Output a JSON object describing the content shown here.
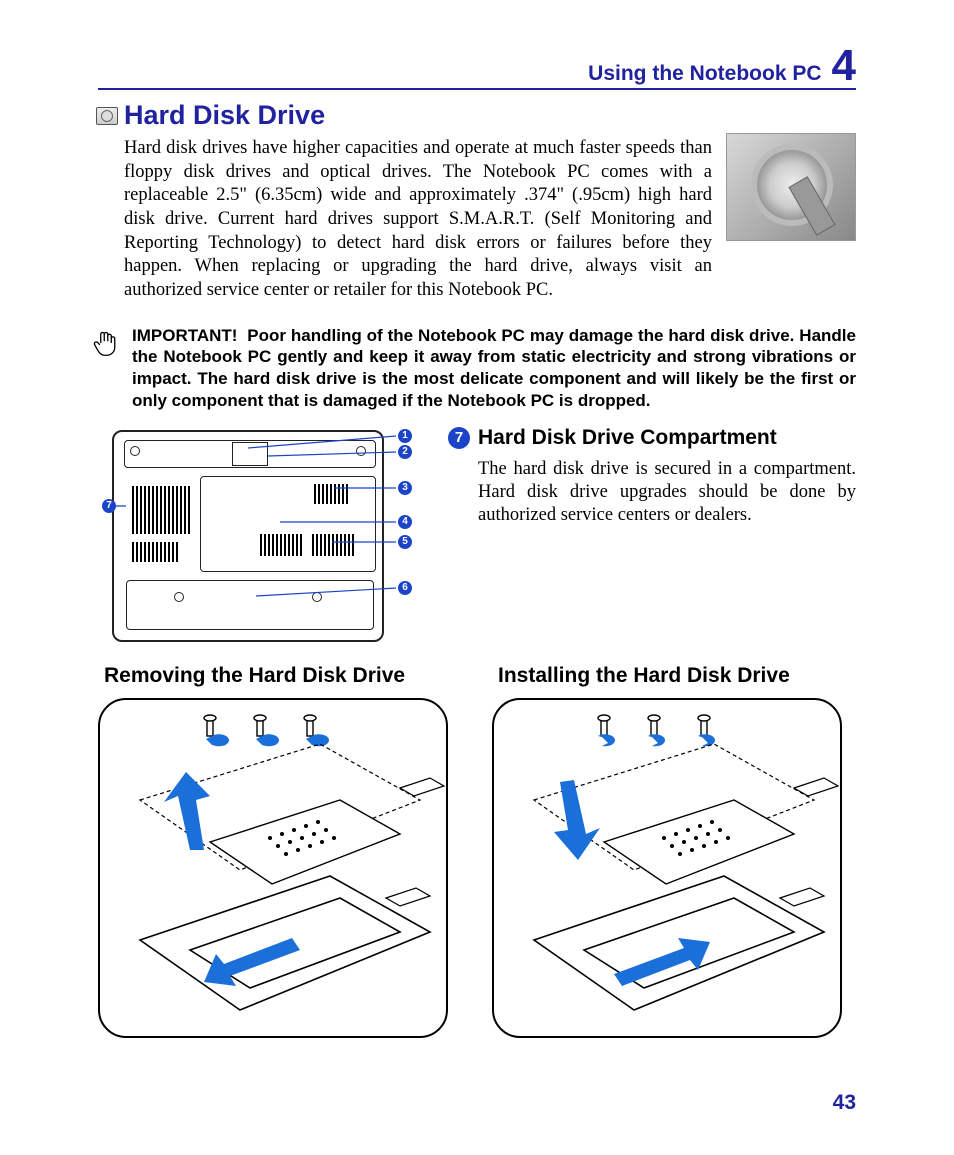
{
  "header": {
    "title": "Using the Notebook PC",
    "chapter": "4"
  },
  "section": {
    "title": "Hard Disk Drive"
  },
  "intro": "Hard disk drives have higher capacities and operate at much faster speeds than floppy disk drives and optical drives. The Notebook PC comes with a replaceable 2.5\" (6.35cm) wide and approximately .374\" (.95cm) high hard disk drive. Current hard drives support S.M.A.R.T. (Self Monitoring and Reporting Technology) to detect hard disk errors or failures before they happen. When replacing or upgrading the hard drive, always visit an authorized service center or retailer for this Notebook PC.",
  "important": {
    "label": "IMPORTANT!",
    "text": "Poor handling of the Notebook PC may damage the hard disk drive. Handle the Notebook PC gently and keep it away from static electricity and strong vibrations or impact. The hard disk drive is the most delicate component and will likely be the first or only component that is damaged if the Notebook PC is dropped."
  },
  "diagram": {
    "callouts": [
      "1",
      "2",
      "3",
      "4",
      "5",
      "6",
      "7"
    ]
  },
  "compartment": {
    "num": "7",
    "title": "Hard Disk Drive Compartment",
    "text": "The hard disk drive is secured in a compartment. Hard disk drive upgrades should be done by authorized service centers or dealers."
  },
  "removing": {
    "title": "Removing the Hard Disk Drive"
  },
  "installing": {
    "title": "Installing the Hard Disk Drive"
  },
  "page": "43"
}
